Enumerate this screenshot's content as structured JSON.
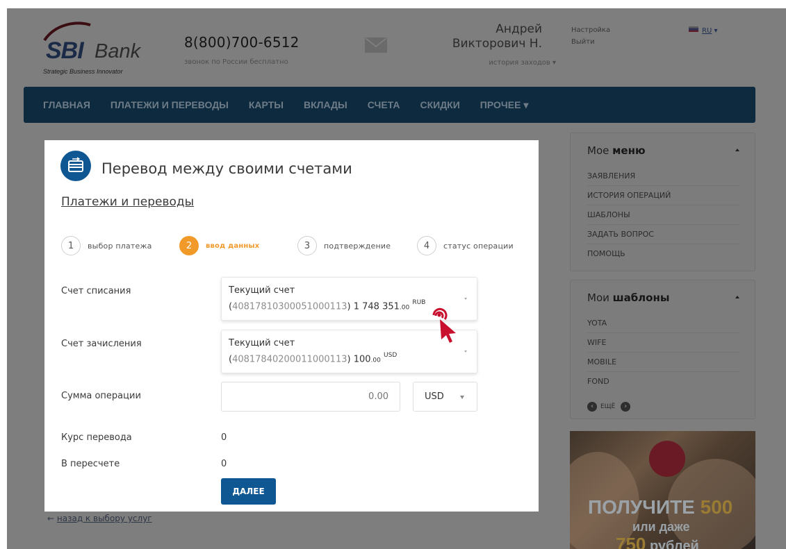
{
  "header": {
    "logo_mark": "SBI",
    "logo_word": "Bank",
    "logo_tagline": "Strategic Business Innovator",
    "phone": "8(800)700-6512",
    "phone_note": "звонок по России бесплатно",
    "user_first_name": "Андрей",
    "user_last_name": "Викторович Н.",
    "login_history": "история заходов",
    "settings": "Настройка",
    "logout": "Выйти",
    "language": "RU"
  },
  "nav": {
    "items": [
      "ГЛАВНАЯ",
      "ПЛАТЕЖИ И ПЕРЕВОДЫ",
      "КАРТЫ",
      "ВКЛАДЫ",
      "СЧЕТА",
      "СКИДКИ"
    ],
    "more": "ПРОЧЕЕ"
  },
  "sidebar": {
    "menu_title_plain": "Мое",
    "menu_title_bold": "меню",
    "menu_items": [
      "ЗАЯВЛЕНИЯ",
      "ИСТОРИЯ ОПЕРАЦИЙ",
      "ШАБЛОНЫ",
      "ЗАДАТЬ ВОПРОС",
      "ПОМОЩЬ"
    ],
    "templates_title_plain": "Мои",
    "templates_title_bold": "шаблоны",
    "template_items": [
      "YOTA",
      "WIFE",
      "MOBILE",
      "FOND"
    ],
    "more_label": "ЕЩЁ"
  },
  "promo": {
    "line1": "ПОЛУЧИТЕ",
    "line1_number": "500",
    "line2": "или даже",
    "line3_number": "750",
    "line3": "рублей"
  },
  "back_link": "назад к выбору услуг",
  "modal": {
    "title": "Перевод между своими счетами",
    "breadcrumb": "Платежи и переводы",
    "steps": [
      {
        "num": "1",
        "label": "выбор платежа"
      },
      {
        "num": "2",
        "label": "ввод данных"
      },
      {
        "num": "3",
        "label": "подтверждение"
      },
      {
        "num": "4",
        "label": "статус операции"
      }
    ],
    "active_step": 2,
    "debit_label": "Счет списания",
    "debit_account": {
      "name": "Текущий счет",
      "number": "40817810300051000113",
      "amount_int": "1 748 351",
      "amount_dec": ".00",
      "currency": "RUB"
    },
    "credit_label": "Счет зачисления",
    "credit_account": {
      "name": "Текущий счет",
      "number": "40817840200011000113",
      "amount_int": "100",
      "amount_dec": ".00",
      "currency": "USD"
    },
    "amount_label": "Сумма операции",
    "amount_placeholder": "0.00",
    "amount_currency": "USD",
    "rate_label": "Курс перевода",
    "rate_value": "0",
    "converted_label": "В пересчете",
    "converted_value": "0",
    "next_button": "ДАЛЕЕ"
  },
  "colors": {
    "brand_blue": "#0f5792",
    "step_active": "#f19a2a",
    "overlay": "#7e7e7e",
    "cursor_red": "#c8102e"
  }
}
